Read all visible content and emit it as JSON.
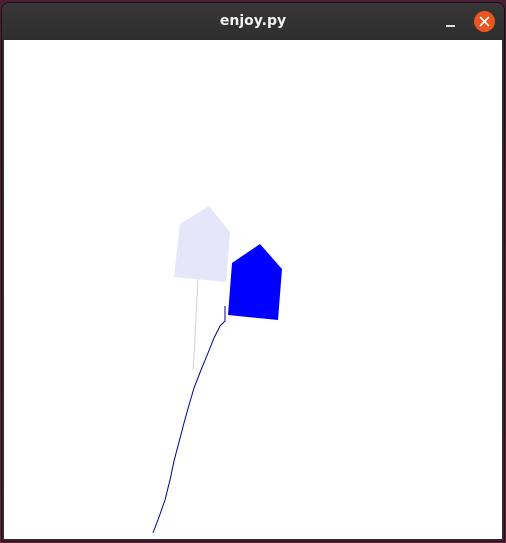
{
  "window": {
    "title": "enjoy.py"
  },
  "colors": {
    "titlebar": "#2e2e2e",
    "close_button": "#e95420",
    "canvas_background": "#ffffff",
    "ghost_agent_fill": "#e6e6fa",
    "ghost_trail": "#d0d0d0",
    "agent_fill": "#0000ff",
    "agent_trail": "#00008b"
  },
  "icons": {
    "minimize": "minimize-icon",
    "close": "close-icon"
  }
}
